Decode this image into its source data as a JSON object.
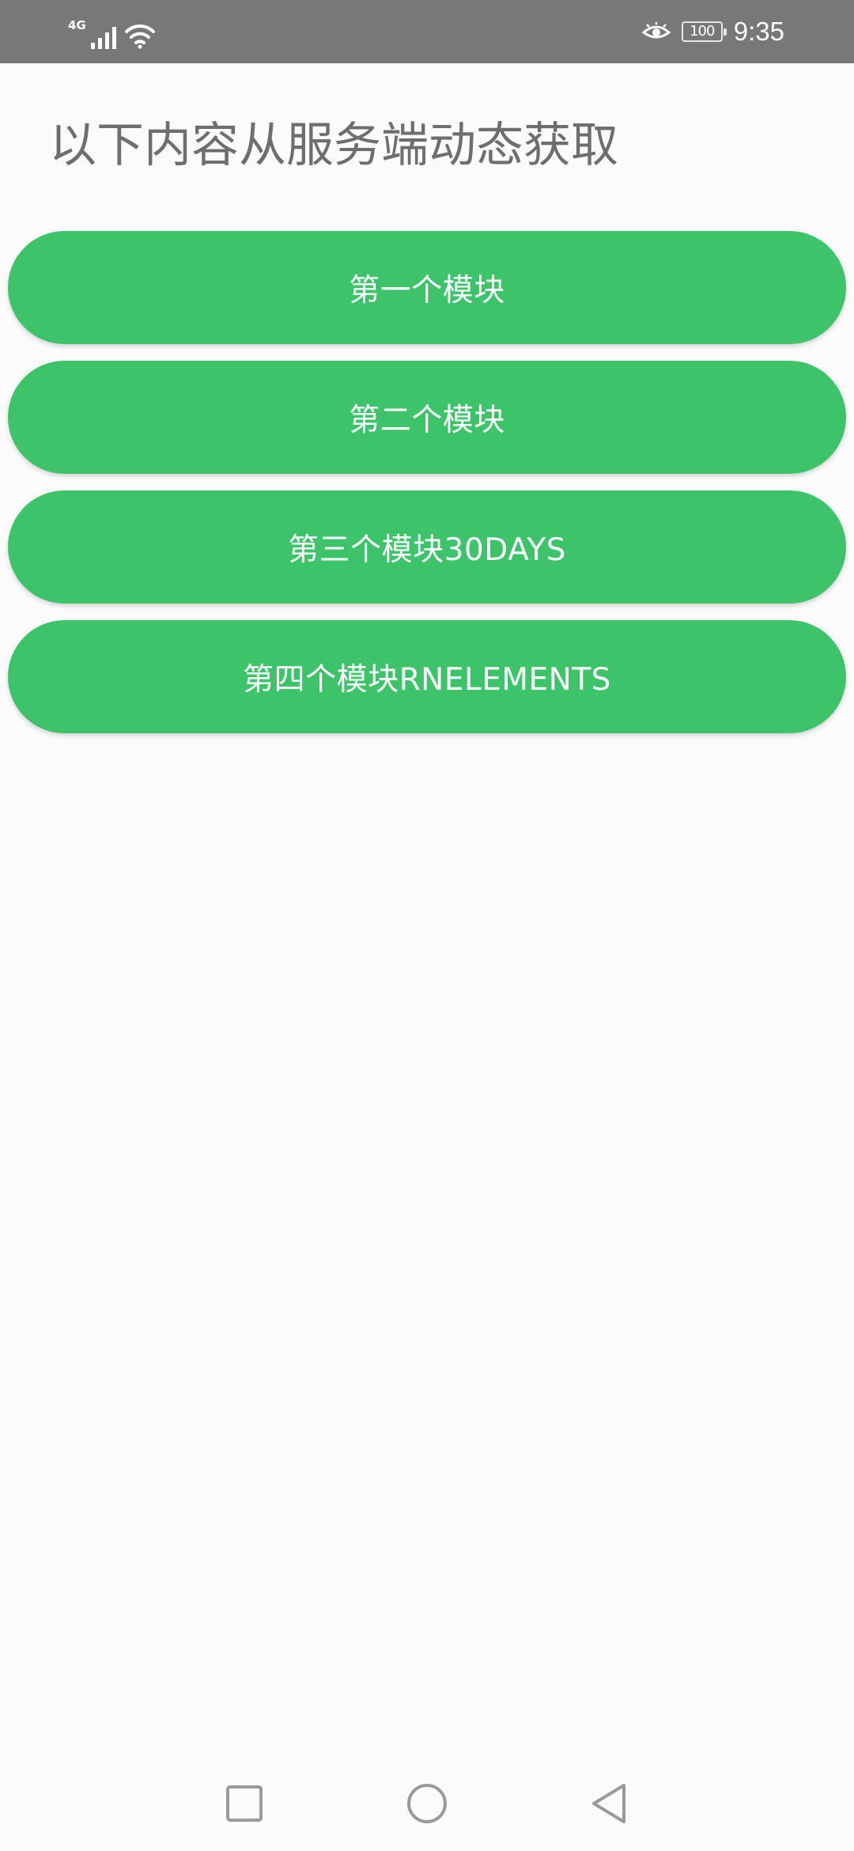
{
  "status_bar": {
    "network_type": "4G",
    "battery_level": "100",
    "time": "9:35",
    "icons": [
      "signal-icon",
      "wifi-icon",
      "eye-icon",
      "battery-icon"
    ]
  },
  "heading": "以下内容从服务端动态获取",
  "modules": [
    {
      "label": "第一个模块"
    },
    {
      "label": "第二个模块"
    },
    {
      "label": "第三个模块30DAYS"
    },
    {
      "label": "第四个模块RNELEMENTS"
    }
  ],
  "colors": {
    "accent": "#3dc46a",
    "status_bar": "#787878",
    "background": "#fbfbfb",
    "heading_text": "#6e6e6e"
  },
  "nav_bar": {
    "icons": [
      "recent-apps-icon",
      "home-icon",
      "back-icon"
    ]
  }
}
